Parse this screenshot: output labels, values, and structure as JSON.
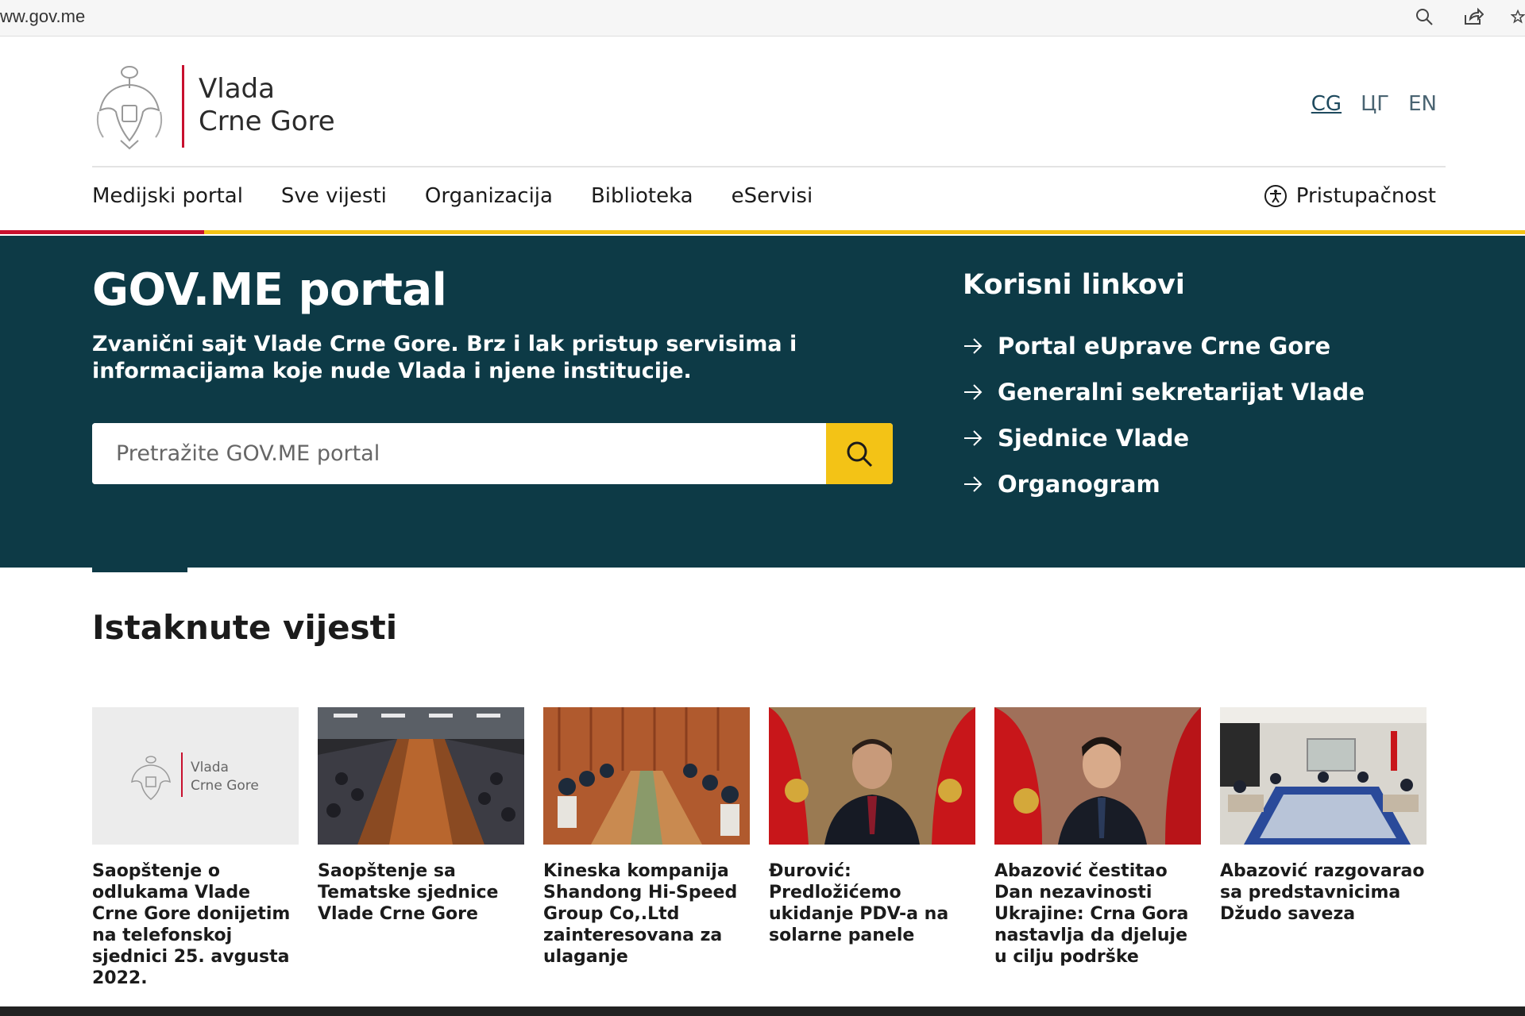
{
  "browser": {
    "url": "ww.gov.me"
  },
  "header": {
    "logo_line1": "Vlada",
    "logo_line2": "Crne Gore",
    "languages": [
      "CG",
      "ЦГ",
      "EN"
    ],
    "nav": [
      "Medijski portal",
      "Sve vijesti",
      "Organizacija",
      "Biblioteka",
      "eServisi"
    ],
    "accessibility": "Pristupačnost"
  },
  "hero": {
    "title": "GOV.ME portal",
    "subtitle": "Zvanični sajt Vlade Crne Gore. Brz i lak pristup servisima i informacijama koje nude Vlada i njene institucije.",
    "search_placeholder": "Pretražite GOV.ME portal",
    "links_title": "Korisni linkovi",
    "links": [
      "Portal eUprave Crne Gore",
      "Generalni sekretarijat Vlade",
      "Sjednice Vlade",
      "Organogram"
    ]
  },
  "news": {
    "title": "Istaknute vijesti",
    "cards": [
      {
        "title": "Saopštenje o odlukama Vlade Crne Gore donijetim na telefonskoj sjednici 25. avgusta 2022.",
        "thumb_logo_line1": "Vlada",
        "thumb_logo_line2": "Crne Gore"
      },
      {
        "title": "Saopštenje sa Tematske sjednice Vlade Crne Gore"
      },
      {
        "title": "Kineska kompanija Shandong Hi-Speed Group Co,.Ltd zainteresovana za ulaganje"
      },
      {
        "title": "Đurović: Predložićemo ukidanje PDV-a na solarne panele"
      },
      {
        "title": "Abazović čestitao Dan nezavinosti Ukrajine: Crna Gora nastavlja da djeluje u cilju podrške"
      },
      {
        "title": "Abazović razgovarao sa predstavnicima Džudo saveza"
      }
    ]
  },
  "colors": {
    "hero_bg": "#0d3a46",
    "accent_yellow": "#f3c316",
    "accent_red": "#c8102e"
  }
}
